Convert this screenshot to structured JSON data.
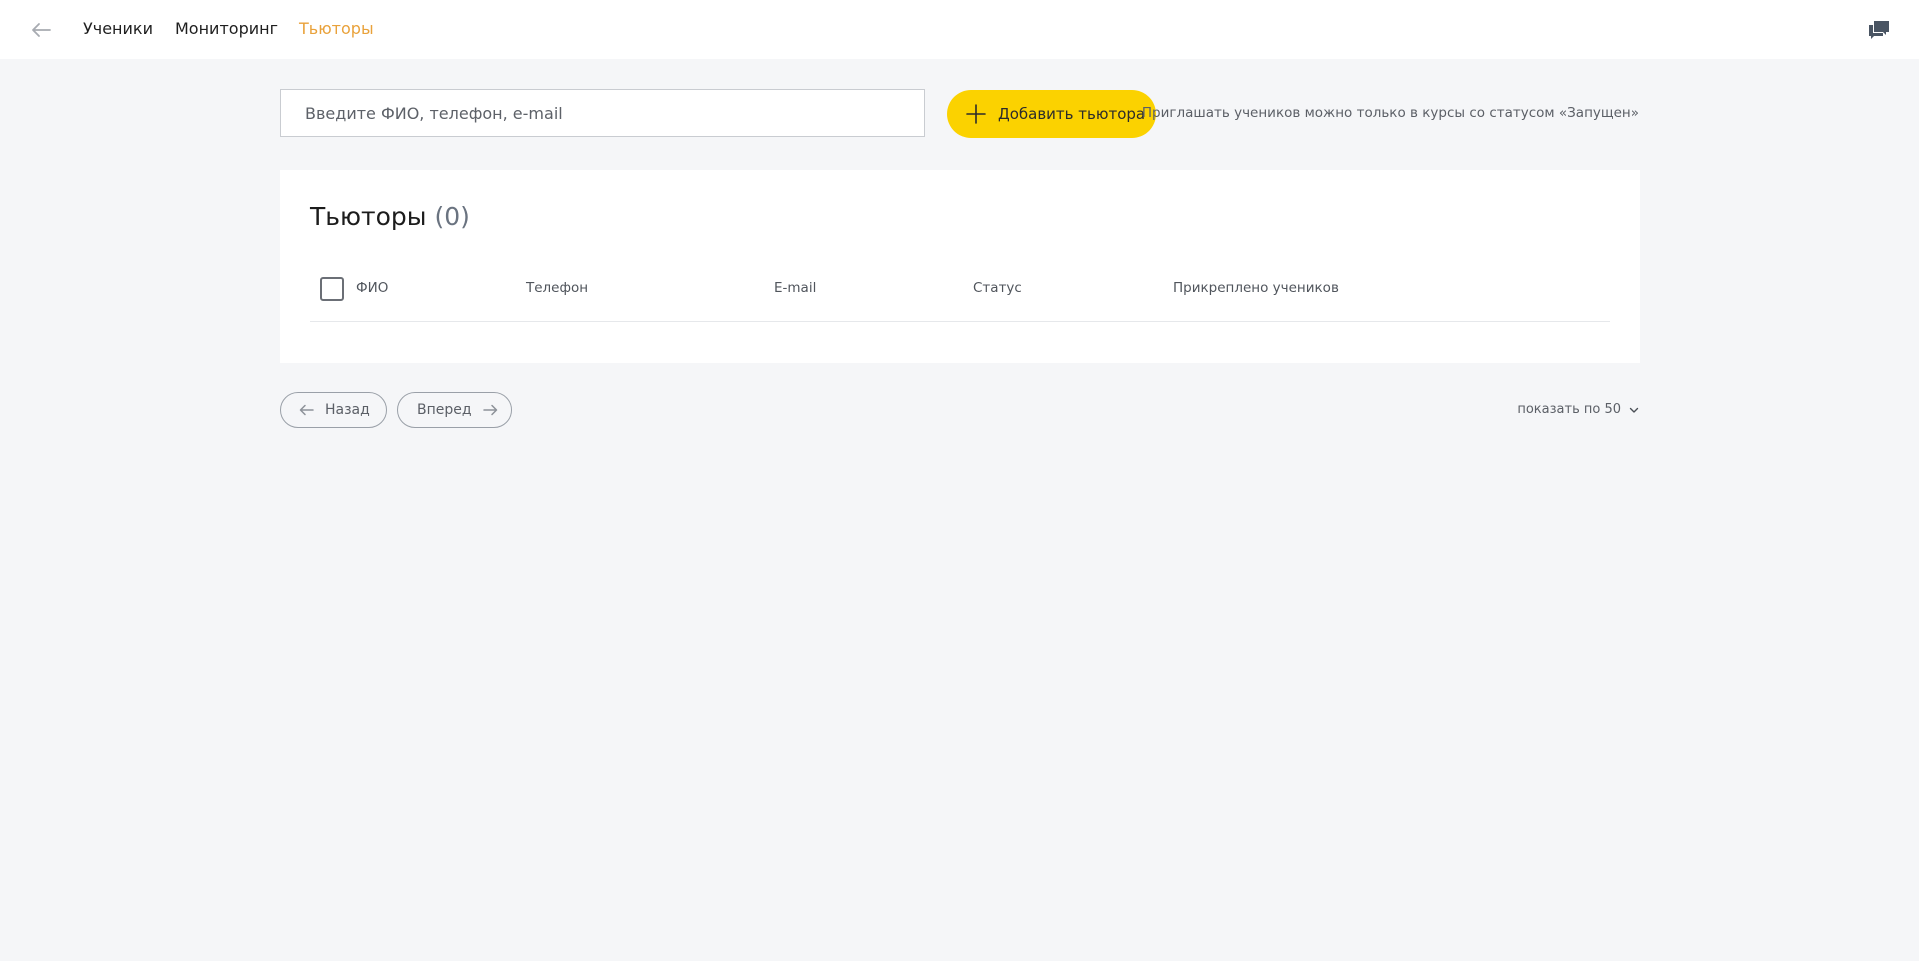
{
  "topbar": {
    "nav": [
      {
        "label": "Ученики",
        "active": false
      },
      {
        "label": "Мониторинг",
        "active": false
      },
      {
        "label": "Тьюторы",
        "active": true
      }
    ],
    "icons": {
      "back": "arrow-left-icon",
      "chat": "chat-bubbles-icon"
    }
  },
  "search": {
    "placeholder": "Введите ФИО, телефон, e-mail",
    "value": ""
  },
  "add_button": {
    "label": "Добавить тьютора",
    "icon": "plus-icon"
  },
  "notice": "Приглашать учеников можно только в курсы со статусом «Запущен»",
  "card": {
    "title": "Тьюторы",
    "count": "(0)",
    "columns": [
      "ФИО",
      "Телефон",
      "E-mail",
      "Статус",
      "Прикреплено учеников"
    ],
    "rows": []
  },
  "pagination": {
    "prev_label": "Назад",
    "next_label": "Вперед",
    "per_page_label": "показать по 50"
  },
  "colors": {
    "accent_yellow": "#fbd200",
    "active_nav": "#e9a23b",
    "background": "#f5f6f8"
  }
}
